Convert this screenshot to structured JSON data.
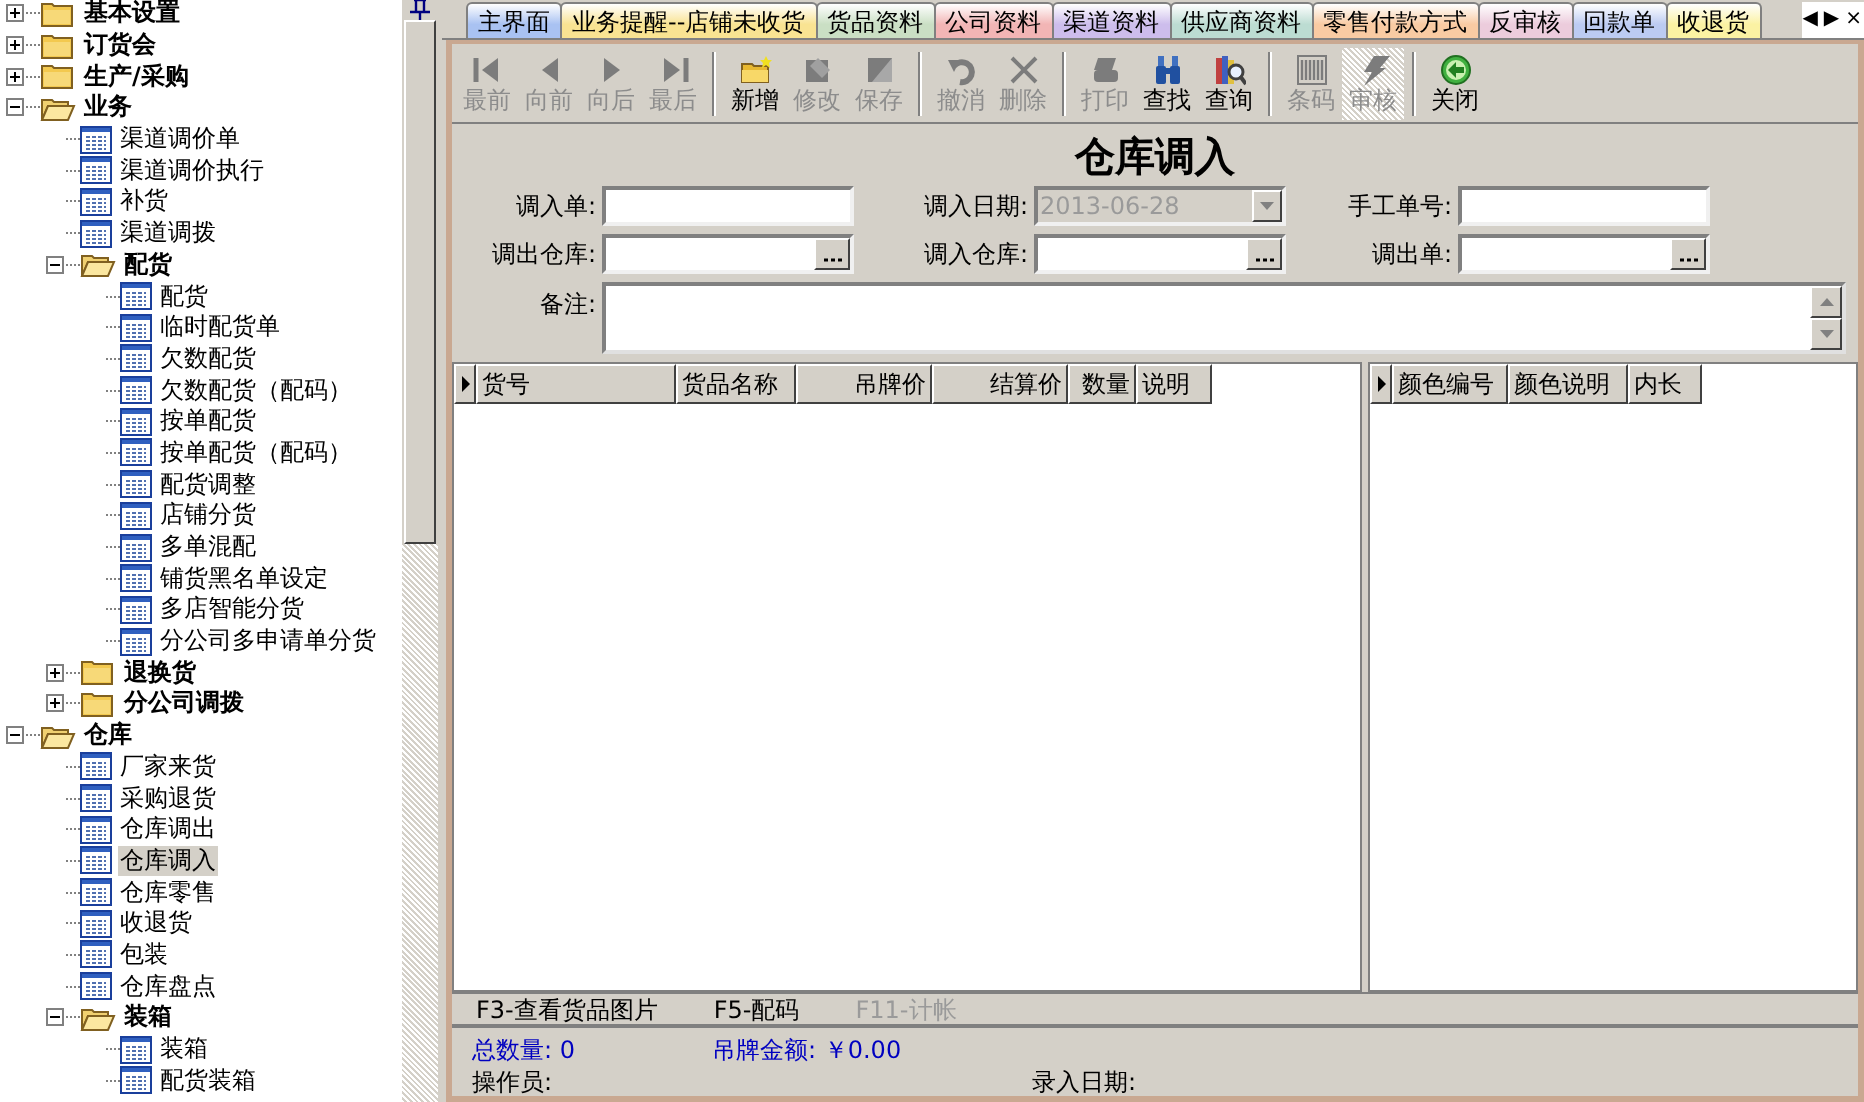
{
  "tree": [
    {
      "label": "基本设置",
      "kind": "folder",
      "expanded": false,
      "selected": false
    },
    {
      "label": "订货会",
      "kind": "folder",
      "expanded": false,
      "selected": false
    },
    {
      "label": "生产/采购",
      "kind": "folder",
      "expanded": false,
      "selected": false
    },
    {
      "label": "业务",
      "kind": "folder",
      "expanded": true,
      "selected": false,
      "children": [
        {
          "label": "渠道调价单",
          "kind": "doc",
          "selected": false
        },
        {
          "label": "渠道调价执行",
          "kind": "doc",
          "selected": false
        },
        {
          "label": "补货",
          "kind": "doc",
          "selected": false
        },
        {
          "label": "渠道调拨",
          "kind": "doc",
          "selected": false
        },
        {
          "label": "配货",
          "kind": "folder",
          "expanded": true,
          "selected": false,
          "children": [
            {
              "label": "配货",
              "kind": "doc",
              "selected": false
            },
            {
              "label": "临时配货单",
              "kind": "doc",
              "selected": false
            },
            {
              "label": "欠数配货",
              "kind": "doc",
              "selected": false
            },
            {
              "label": "欠数配货（配码）",
              "kind": "doc",
              "selected": false
            },
            {
              "label": "按单配货",
              "kind": "doc",
              "selected": false
            },
            {
              "label": "按单配货（配码）",
              "kind": "doc",
              "selected": false
            },
            {
              "label": "配货调整",
              "kind": "doc",
              "selected": false
            },
            {
              "label": "店铺分货",
              "kind": "doc",
              "selected": false
            },
            {
              "label": "多单混配",
              "kind": "doc",
              "selected": false
            },
            {
              "label": "铺货黑名单设定",
              "kind": "doc",
              "selected": false
            },
            {
              "label": "多店智能分货",
              "kind": "doc",
              "selected": false
            },
            {
              "label": "分公司多申请单分货",
              "kind": "doc",
              "selected": false
            }
          ]
        },
        {
          "label": "退换货",
          "kind": "folder",
          "expanded": false,
          "selected": false
        },
        {
          "label": "分公司调拨",
          "kind": "folder",
          "expanded": false,
          "selected": false
        }
      ]
    },
    {
      "label": "仓库",
      "kind": "folder",
      "expanded": true,
      "selected": false,
      "children": [
        {
          "label": "厂家来货",
          "kind": "doc",
          "selected": false
        },
        {
          "label": "采购退货",
          "kind": "doc",
          "selected": false
        },
        {
          "label": "仓库调出",
          "kind": "doc",
          "selected": false
        },
        {
          "label": "仓库调入",
          "kind": "doc",
          "selected": true
        },
        {
          "label": "仓库零售",
          "kind": "doc",
          "selected": false
        },
        {
          "label": "收退货",
          "kind": "doc",
          "selected": false
        },
        {
          "label": "包装",
          "kind": "doc",
          "selected": false
        },
        {
          "label": "仓库盘点",
          "kind": "doc",
          "selected": false
        },
        {
          "label": "装箱",
          "kind": "folder",
          "expanded": true,
          "selected": false,
          "children": [
            {
              "label": "装箱",
              "kind": "doc",
              "selected": false
            },
            {
              "label": "配货装箱",
              "kind": "doc",
              "selected": false
            }
          ]
        }
      ]
    }
  ],
  "tabs": [
    {
      "label": "主界面",
      "color": "#a9c2f2"
    },
    {
      "label": "业务提醒--店铺未收货",
      "color": "#f9e392"
    },
    {
      "label": "货品资料",
      "color": "#cadfc4"
    },
    {
      "label": "公司资料",
      "color": "#f2b5b5"
    },
    {
      "label": "渠道资料",
      "color": "#cdbdec"
    },
    {
      "label": "供应商资料",
      "color": "#bcdcd2"
    },
    {
      "label": "零售付款方式",
      "color": "#f9cba3"
    },
    {
      "label": "反审核",
      "color": "#ecccdc"
    },
    {
      "label": "回款单",
      "color": "#bccbf2"
    },
    {
      "label": "收退货",
      "color": "#fbf2a3"
    }
  ],
  "tab_nav": [
    "◀",
    "▶",
    "×"
  ],
  "toolbar": [
    {
      "label": "最前",
      "kind": "first",
      "disabled": true
    },
    {
      "label": "向前",
      "kind": "prev",
      "disabled": true
    },
    {
      "label": "向后",
      "kind": "next",
      "disabled": true
    },
    {
      "label": "最后",
      "kind": "last",
      "disabled": true,
      "sep": true
    },
    {
      "label": "新增",
      "kind": "new",
      "disabled": false
    },
    {
      "label": "修改",
      "kind": "edit",
      "disabled": true
    },
    {
      "label": "保存",
      "kind": "save",
      "disabled": true,
      "sep": true
    },
    {
      "label": "撤消",
      "kind": "undo",
      "disabled": true
    },
    {
      "label": "删除",
      "kind": "delete",
      "disabled": true,
      "sep": true
    },
    {
      "label": "打印",
      "kind": "print",
      "disabled": true
    },
    {
      "label": "查找",
      "kind": "find",
      "disabled": false
    },
    {
      "label": "查询",
      "kind": "query",
      "disabled": false,
      "sep": true
    },
    {
      "label": "条码",
      "kind": "barcode",
      "disabled": true
    },
    {
      "label": "审核",
      "kind": "audit",
      "disabled": true,
      "sep": true
    },
    {
      "label": "关闭",
      "kind": "close",
      "disabled": false
    }
  ],
  "form_title": "仓库调入",
  "fields": [
    {
      "label": "调入单:",
      "kind": "text"
    },
    {
      "label": "调入日期:",
      "kind": "date",
      "value": "2013-06-28",
      "disabled": true
    },
    {
      "label": "手工单号:",
      "kind": "text"
    },
    {
      "label": "调出仓库:",
      "kind": "lookup"
    },
    {
      "label": "调入仓库:",
      "kind": "lookup"
    },
    {
      "label": "调出单:",
      "kind": "lookup"
    }
  ],
  "remark": {
    "label": "备注:"
  },
  "items_grid": {
    "columns": [
      {
        "label": "货号",
        "kind": "text"
      },
      {
        "label": "货品名称",
        "kind": "text"
      },
      {
        "label": "吊牌价",
        "kind": "numeric"
      },
      {
        "label": "结算价",
        "kind": "numeric"
      },
      {
        "label": "数量",
        "kind": "numeric"
      },
      {
        "label": "说明",
        "kind": "text"
      }
    ]
  },
  "color_grid": {
    "columns": [
      {
        "label": "颜色编号"
      },
      {
        "label": "颜色说明"
      },
      {
        "label": "内长"
      }
    ]
  },
  "hotkeys": [
    {
      "label": "F3-查看货品图片",
      "disabled": false
    },
    {
      "label": "F5-配码",
      "disabled": false
    },
    {
      "label": "F11-计帐",
      "disabled": true
    }
  ],
  "status": {
    "total_qty": "总数量: 0",
    "tag_amount": "吊牌金额: ￥0.00",
    "operator": "操作员:",
    "entry_date": "录入日期:"
  }
}
